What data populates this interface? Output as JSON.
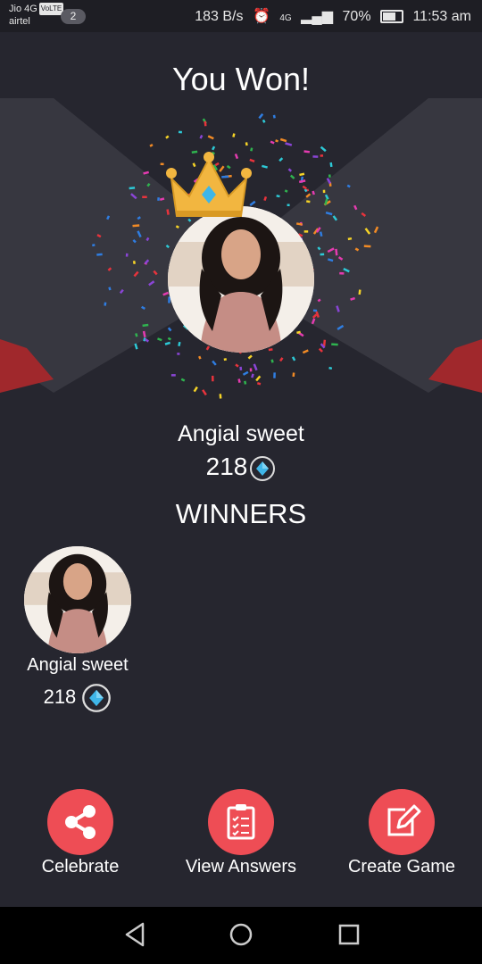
{
  "status_bar": {
    "carrier1": "Jio 4G",
    "volte": "VoLTE",
    "carrier2": "airtel",
    "notification_count": "2",
    "speed": "183 B/s",
    "network": "4G",
    "battery": "70%",
    "time": "11:53 am"
  },
  "title": "You Won!",
  "winner": {
    "name": "Angial sweet",
    "score": "218"
  },
  "winners_heading": "WINNERS",
  "winners_list": [
    {
      "name": "Angial sweet",
      "score": "218"
    }
  ],
  "actions": {
    "celebrate": "Celebrate",
    "view_answers": "View Answers",
    "create_game": "Create Game"
  },
  "colors": {
    "accent": "#ee4d55",
    "background": "#26262f",
    "crown": "#f2b640",
    "gem": "#3fb6e8"
  }
}
